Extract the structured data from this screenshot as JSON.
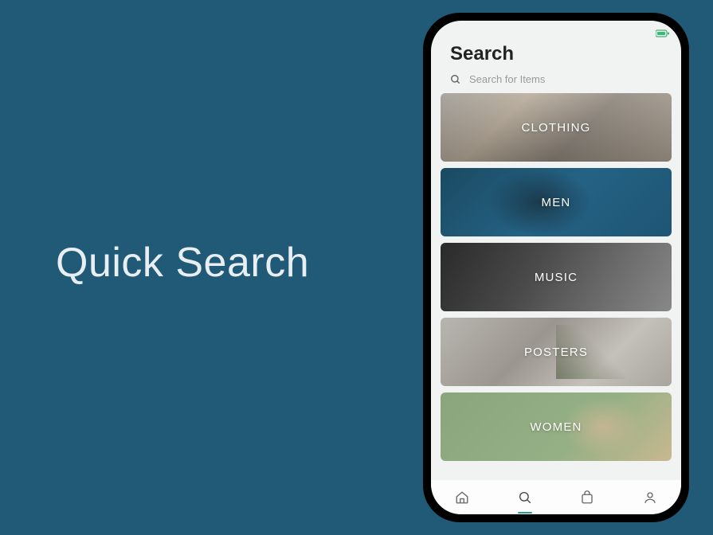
{
  "hero": {
    "title": "Quick Search"
  },
  "app": {
    "title": "Search",
    "search_placeholder": "Search for Items"
  },
  "categories": [
    {
      "label": "CLOTHING",
      "key": "clothing"
    },
    {
      "label": "MEN",
      "key": "men"
    },
    {
      "label": "MUSIC",
      "key": "music"
    },
    {
      "label": "POSTERS",
      "key": "posters"
    },
    {
      "label": "WOMEN",
      "key": "women"
    }
  ],
  "nav": {
    "items": [
      {
        "name": "home",
        "active": false
      },
      {
        "name": "search",
        "active": true
      },
      {
        "name": "bag",
        "active": false
      },
      {
        "name": "profile",
        "active": false
      }
    ]
  }
}
